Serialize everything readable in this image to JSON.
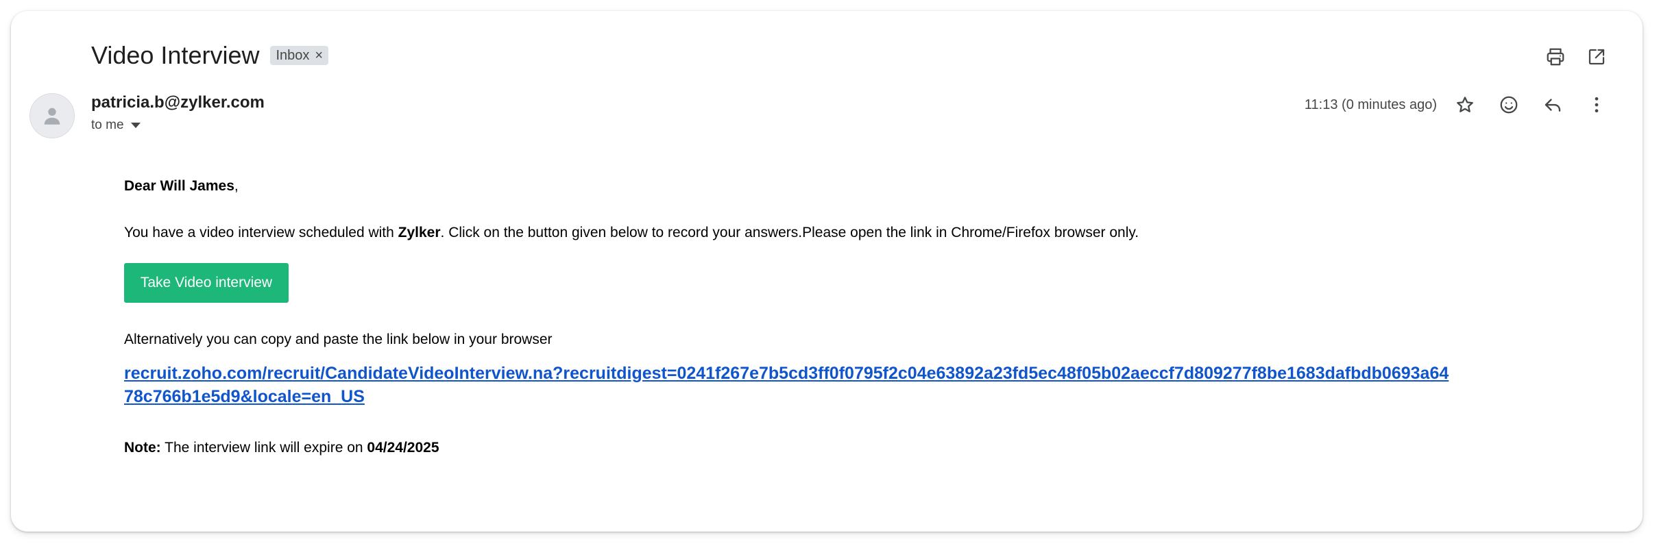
{
  "header": {
    "subject": "Video Interview",
    "label": "Inbox",
    "label_close": "×",
    "icons": [
      "print-icon",
      "open-in-new-window-icon"
    ]
  },
  "sender": {
    "email": "patricia.b@zylker.com",
    "to": "to me",
    "time": "11:13 (0 minutes ago)",
    "icons": [
      "star-icon",
      "emoji-react-icon",
      "reply-icon",
      "more-vert-icon"
    ]
  },
  "message": {
    "greeting_prefix": "Dear ",
    "greeting_name": "Will James",
    "greeting_suffix": ",",
    "para_prefix": "You have a video interview scheduled with ",
    "company": "Zylker",
    "para_suffix": ". Click on the button given below to record your answers.Please open the link in Chrome/Firefox browser only.",
    "button_label": "Take Video interview",
    "alt_text": "Alternatively you can copy and paste the link below in your browser",
    "link": "recruit.zoho.com/recruit/CandidateVideoInterview.na?recruitdigest=0241f267e7b5cd3ff0f0795f2c04e63892a23fd5ec48f05b02aeccf7d809277f8be1683dafbdb0693a6478c766b1e5d9&locale=en_US",
    "note_label": "Note:",
    "note_text": " The interview link will expire on ",
    "note_date": "04/24/2025"
  },
  "colors": {
    "button": "#1db77a",
    "link": "#1155cc",
    "chip": "#dde1e6"
  }
}
